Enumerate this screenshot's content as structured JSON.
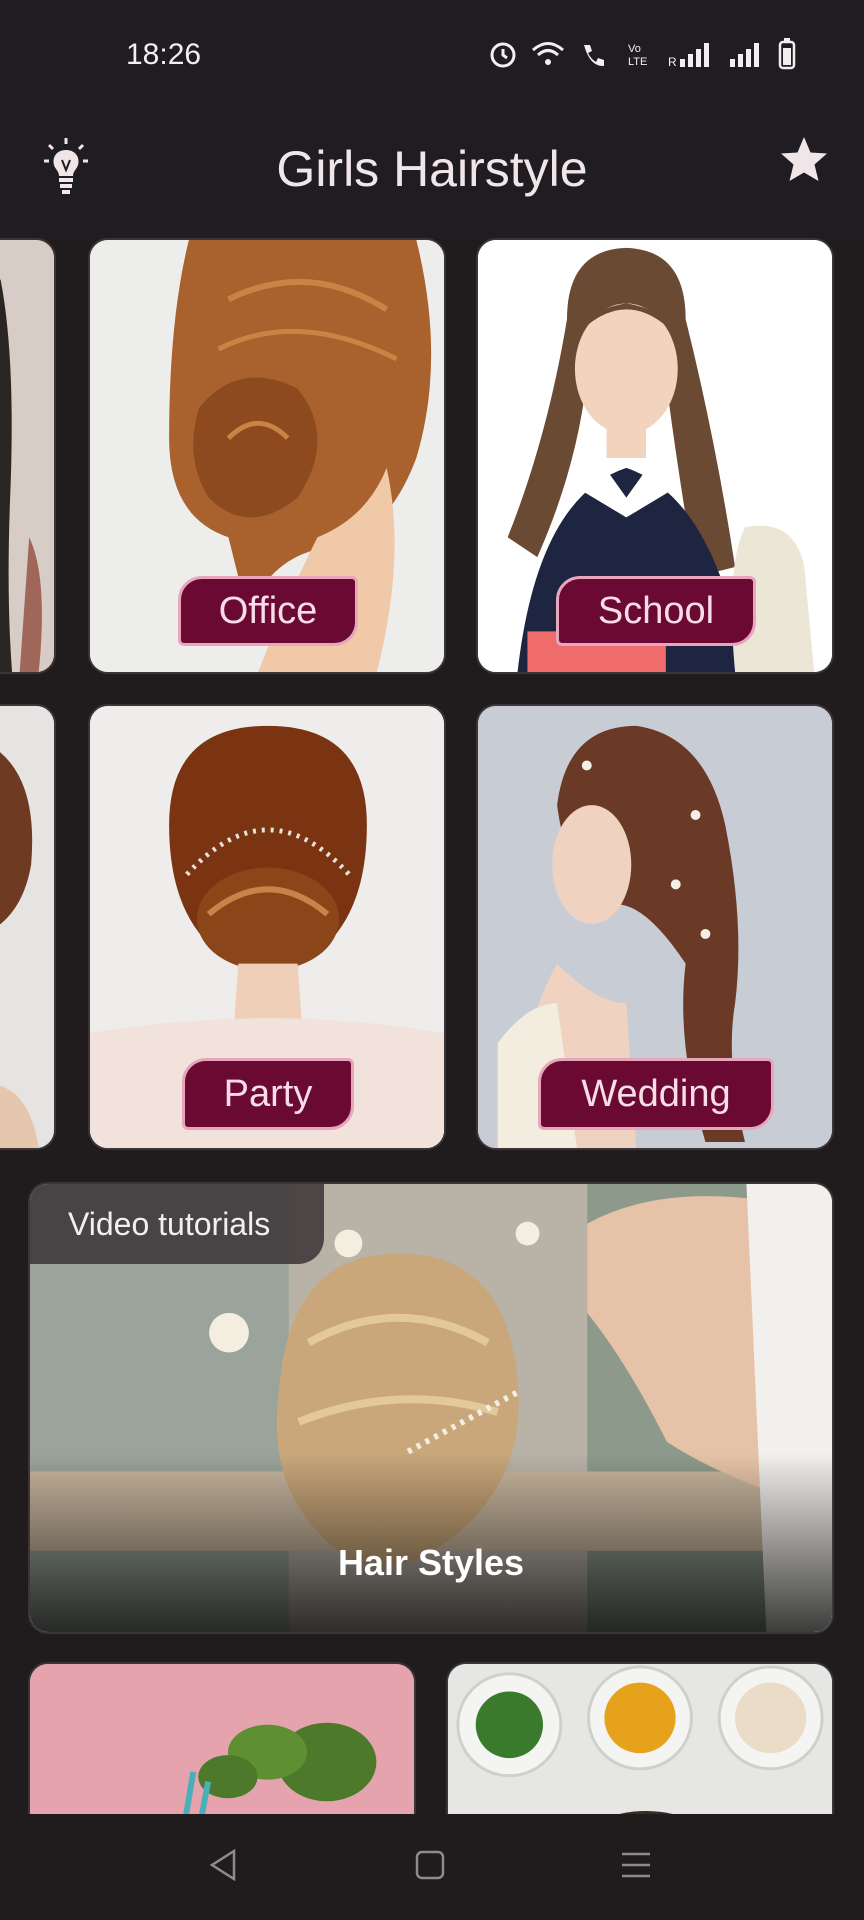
{
  "status": {
    "time": "18:26"
  },
  "app": {
    "title": "Girls Hairstyle"
  },
  "categories": [
    {
      "label": "Office"
    },
    {
      "label": "School"
    },
    {
      "label": "Party"
    },
    {
      "label": "Wedding"
    }
  ],
  "video": {
    "badge": "Video tutorials",
    "caption": "Hair Styles"
  },
  "colors": {
    "accent": "#6a0a33",
    "accent_border": "#e8a6bd",
    "background": "#201b1d",
    "bar": "#1f1c22"
  }
}
